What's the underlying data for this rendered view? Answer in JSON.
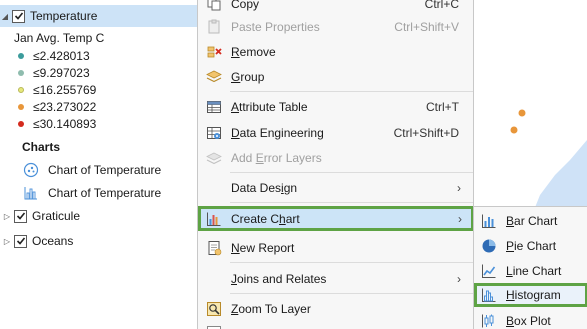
{
  "toc": {
    "layer_temperature": "Temperature",
    "field_label": "Jan Avg. Temp C",
    "legend": [
      {
        "label": "≤2.428013",
        "color": "#3c9c9c"
      },
      {
        "label": "≤9.297023",
        "color": "#8fbcae"
      },
      {
        "label": "≤16.255769",
        "color": "#e6e87a"
      },
      {
        "label": "≤23.273022",
        "color": "#e8963a"
      },
      {
        "label": "≤30.140893",
        "color": "#d42b1e"
      }
    ],
    "charts_heading": "Charts",
    "charts": [
      {
        "label": "Chart of Temperature",
        "icon": "scatter-chart-icon"
      },
      {
        "label": "Chart of Temperature",
        "icon": "histogram-chart-icon"
      }
    ],
    "layer_graticule": "Graticule",
    "layer_oceans": "Oceans"
  },
  "menu": {
    "copy": {
      "label": "Copy",
      "shortcut": "Ctrl+C"
    },
    "paste_properties": {
      "label": "Paste Properties",
      "shortcut": "Ctrl+Shift+V"
    },
    "remove": {
      "label": "Remove"
    },
    "group": {
      "label": "Group"
    },
    "attribute_table": {
      "label": "Attribute Table",
      "shortcut": "Ctrl+T"
    },
    "data_engineering": {
      "label": "Data Engineering",
      "shortcut": "Ctrl+Shift+D"
    },
    "add_error_layers": {
      "label": "Add Error Layers"
    },
    "data_design": {
      "label": "Data Design"
    },
    "create_chart": {
      "label": "Create Chart"
    },
    "new_report": {
      "label": "New Report"
    },
    "joins_relates": {
      "label": "Joins and Relates"
    },
    "zoom_to_layer": {
      "label": "Zoom To Layer"
    }
  },
  "submenu": {
    "bar_chart": "Bar Chart",
    "pie_chart": "Pie Chart",
    "line_chart": "Line Chart",
    "histogram": "Histogram",
    "box_plot": "Box Plot"
  },
  "colors": {
    "highlight_outline": "#5ea345",
    "selection": "#cde3f7",
    "map_water": "#cfe2f7",
    "map_point": "#e8963a"
  }
}
